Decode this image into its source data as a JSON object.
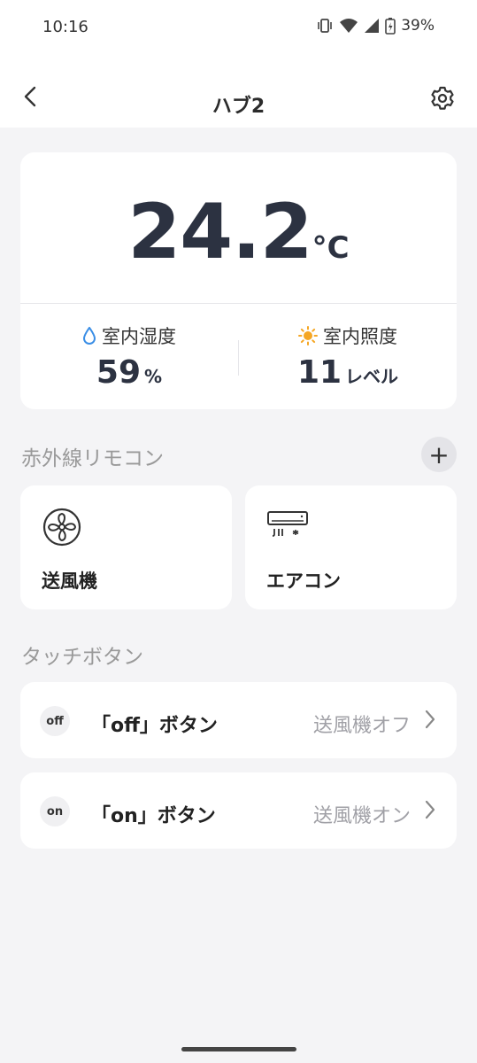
{
  "status_bar": {
    "time": "10:16",
    "battery": "39%"
  },
  "header": {
    "title": "ハブ2"
  },
  "sensor": {
    "temperature": "24.2",
    "temperature_unit": "°C",
    "humidity_label": "室内湿度",
    "humidity_value": "59",
    "humidity_unit": "%",
    "illuminance_label": "室内照度",
    "illuminance_value": "11",
    "illuminance_unit": "レベル"
  },
  "ir_remote": {
    "section_title": "赤外線リモコン",
    "add_label": "+",
    "devices": [
      {
        "label": "送風機",
        "icon": "fan-icon"
      },
      {
        "label": "エアコン",
        "icon": "air-conditioner-icon"
      }
    ]
  },
  "touch_buttons": {
    "section_title": "タッチボタン",
    "items": [
      {
        "badge": "off",
        "name": "「off」ボタン",
        "action": "送風機オフ"
      },
      {
        "badge": "on",
        "name": "「on」ボタン",
        "action": "送風機オン"
      }
    ]
  },
  "colors": {
    "accent_blue": "#3a8ee6",
    "accent_sun": "#f5a623",
    "text_dark": "#2c3241"
  }
}
